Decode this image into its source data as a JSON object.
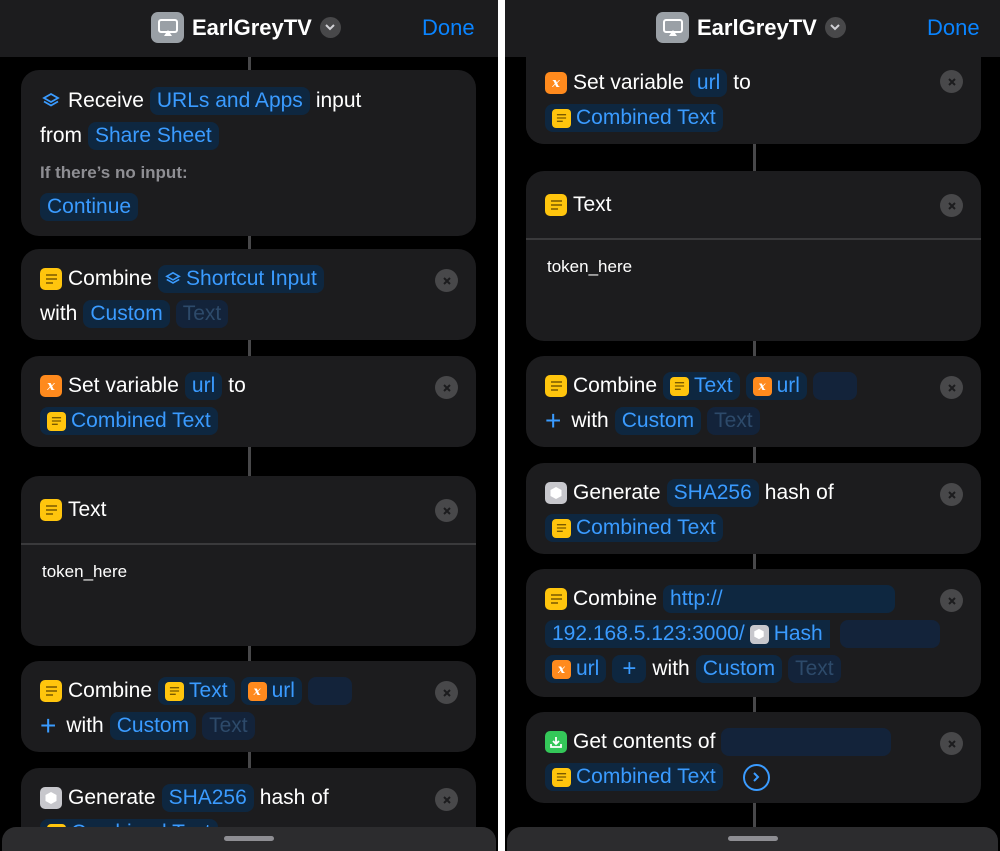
{
  "header": {
    "title": "EarlGreyTV",
    "done_label": "Done"
  },
  "actions": {
    "receive": {
      "verb": "Receive",
      "types": "URLs and Apps",
      "input_word": "input",
      "from_word": "from",
      "source": "Share Sheet",
      "no_input_label": "If there’s no input:",
      "no_input_value": "Continue"
    },
    "combine1": {
      "verb": "Combine",
      "input": "Shortcut Input",
      "with_word": "with",
      "mode": "Custom",
      "placeholder": "Text"
    },
    "setvar": {
      "verb": "Set variable",
      "name": "url",
      "to_word": "to",
      "value": "Combined Text"
    },
    "text": {
      "title": "Text",
      "content": "token_here"
    },
    "combine2": {
      "verb": "Combine",
      "item1": "Text",
      "item2": "url",
      "with_word": "with",
      "mode": "Custom",
      "placeholder": "Text"
    },
    "hash": {
      "verb": "Generate",
      "algorithm": "SHA256",
      "hash_of": "hash of",
      "input": "Combined Text"
    },
    "combine3": {
      "verb": "Combine",
      "prefix": "http://",
      "host": "192.168.5.123:3000/",
      "hash_token": "Hash",
      "url_token": "url",
      "with_word": "with",
      "mode": "Custom",
      "placeholder": "Text"
    },
    "getcontents": {
      "verb": "Get contents of",
      "input": "Combined Text"
    }
  },
  "icons": {
    "app": "airplay-tv-icon",
    "chevron": "chevron-down-icon",
    "receive": "layers-icon",
    "text": "text-doc-icon",
    "variable": "variable-x-icon",
    "hash": "hexagon-icon",
    "download": "download-icon",
    "remove": "close-icon",
    "add": "plus-icon",
    "more": "arrow-right-circle-icon"
  },
  "colors": {
    "accent": "#0a84ff",
    "card": "#1c1c1e",
    "header": "#1c1c1e",
    "text_yellow": "#ffc50d",
    "variable_orange": "#ff8a1d",
    "download_green": "#34c759"
  }
}
